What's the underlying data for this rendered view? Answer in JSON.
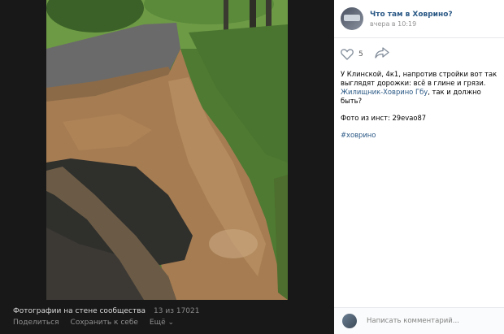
{
  "viewer": {
    "title": "Фотографии на стене сообщества",
    "counter": "13 из 17021",
    "actions": [
      "Поделиться",
      "Сохранить к себе",
      "Ещё"
    ],
    "more_arrow": "⌄"
  },
  "post": {
    "group_name": "Что там в Ховрино?",
    "time": "вчера в 10:19",
    "likes": "5",
    "text_part1": "У Клинской, 4к1, напротив стройки вот так выглядят дорожки: всё в глине и грязи.",
    "link_text": "Жилищник-Ховрино Гбу",
    "text_part2": ", так и должно быть?",
    "photo_credit": "Фото из инст: 29evao87",
    "hashtag": "#ховрино"
  },
  "comment": {
    "placeholder": "Написать комментарий..."
  },
  "icons": {
    "like": "heart-icon",
    "share": "share-icon"
  },
  "colors": {
    "link": "#2a5885",
    "viewer_bg": "#181818",
    "mud": "#a67c52"
  }
}
